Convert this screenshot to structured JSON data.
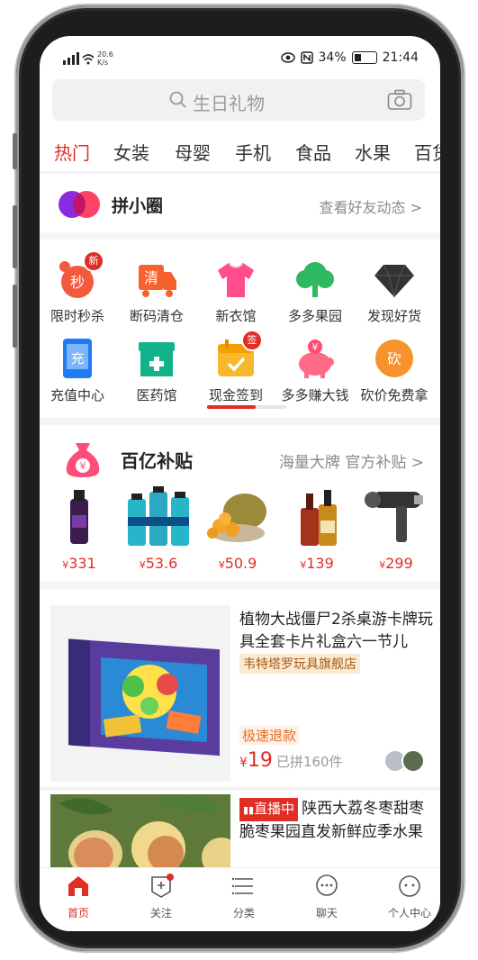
{
  "status": {
    "network_speed": "20.6",
    "network_unit": "K/s",
    "battery": "34%",
    "time": "21:44"
  },
  "search": {
    "placeholder": "生日礼物"
  },
  "tabs": [
    "热门",
    "女装",
    "母婴",
    "手机",
    "食品",
    "水果",
    "百货"
  ],
  "pin_circle": {
    "title": "拼小圈",
    "link": "查看好友动态 >"
  },
  "grid": {
    "row1": [
      {
        "label": "限时秒杀",
        "icon": "alarm-clock-icon",
        "badge": "新",
        "glyph": "秒"
      },
      {
        "label": "断码清仓",
        "icon": "truck-icon",
        "glyph": "清"
      },
      {
        "label": "新衣馆",
        "icon": "shirt-icon"
      },
      {
        "label": "多多果园",
        "icon": "tree-icon"
      },
      {
        "label": "发现好货",
        "icon": "diamond-icon"
      }
    ],
    "row2": [
      {
        "label": "充值中心",
        "icon": "phone-topup-icon",
        "glyph": "充"
      },
      {
        "label": "医药馆",
        "icon": "medicine-box-icon"
      },
      {
        "label": "现金签到",
        "icon": "calendar-check-icon",
        "badge": "签"
      },
      {
        "label": "多多赚大钱",
        "icon": "piggy-bank-icon",
        "glyph": "¥"
      },
      {
        "label": "砍价免费拿",
        "icon": "bargain-icon",
        "glyph": "砍"
      }
    ]
  },
  "subsidy": {
    "title": "百亿补贴",
    "link": "海量大牌 官方补贴 >",
    "products": [
      {
        "currency": "¥",
        "price": "331"
      },
      {
        "currency": "¥",
        "price": "53.6"
      },
      {
        "currency": "¥",
        "price": "50.9"
      },
      {
        "currency": "¥",
        "price": "139"
      },
      {
        "currency": "¥",
        "price": "299"
      }
    ]
  },
  "feed": {
    "card1": {
      "title": "植物大战僵尸2杀桌游卡牌玩具全套卡片礼盒六一节儿",
      "shop": "韦特塔罗玩具旗舰店",
      "tag": "极速退款",
      "currency": "¥",
      "price": "19",
      "sold": "已拼160件"
    },
    "card2": {
      "live_tag": "直播中",
      "title": "陕西大荔冬枣甜枣脆枣果园直发新鲜应季水果"
    }
  },
  "bottom_nav": [
    "首页",
    "关注",
    "分类",
    "聊天",
    "个人中心"
  ],
  "colors": {
    "accent": "#e02e24"
  }
}
